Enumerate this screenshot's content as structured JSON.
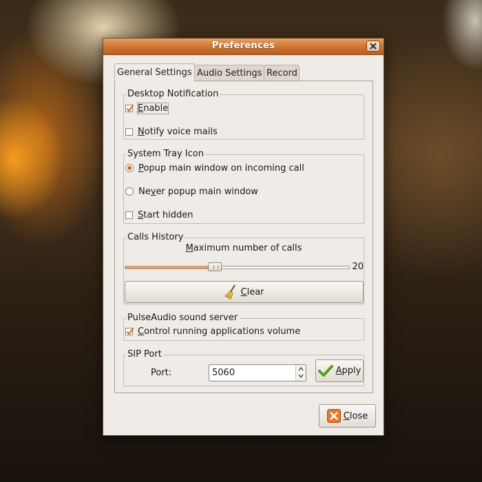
{
  "window": {
    "title": "Preferences"
  },
  "tabs": [
    {
      "label": "General Settings",
      "active": true
    },
    {
      "label": "Audio Settings",
      "active": false
    },
    {
      "label": "Record",
      "active": false
    }
  ],
  "desktop_notification": {
    "label": "Desktop Notification",
    "enable": {
      "mnemonic": "E",
      "rest": "nable",
      "checked": true
    },
    "notify_voice_mails": {
      "mnemonic": "N",
      "rest": "otify voice mails",
      "checked": false
    }
  },
  "system_tray": {
    "label": "System Tray Icon",
    "popup_main": {
      "mnemonic": "P",
      "rest": "opup main window on incoming call",
      "selected": true
    },
    "never_popup": {
      "pre": "Ne",
      "mnemonic": "v",
      "rest": "er popup main window",
      "selected": false
    },
    "start_hidden": {
      "mnemonic": "S",
      "rest": "tart hidden",
      "checked": false
    }
  },
  "calls_history": {
    "label": "Calls History",
    "slider_label": {
      "mnemonic": "M",
      "rest": "aximum number of calls"
    },
    "slider_value": "20",
    "slider_fraction": 0.4,
    "clear_button": {
      "mnemonic": "C",
      "rest": "lear",
      "icon": "broom-icon"
    }
  },
  "pulseaudio": {
    "label": "PulseAudio sound server",
    "control_volume": {
      "mnemonic": "C",
      "rest": "ontrol running applications volume",
      "checked": true
    }
  },
  "sip_port": {
    "label": "SIP Port",
    "port_label": "Port:",
    "port_value": "5060",
    "apply_button": {
      "mnemonic": "A",
      "rest": "pply",
      "icon": "checkmark-icon"
    }
  },
  "footer": {
    "close_button": {
      "mnemonic": "C",
      "rest": "lose",
      "icon": "close-icon"
    }
  },
  "colors": {
    "accent": "#e28d3a",
    "titlebar": "#d07a38",
    "window_bg": "#efebe6"
  }
}
